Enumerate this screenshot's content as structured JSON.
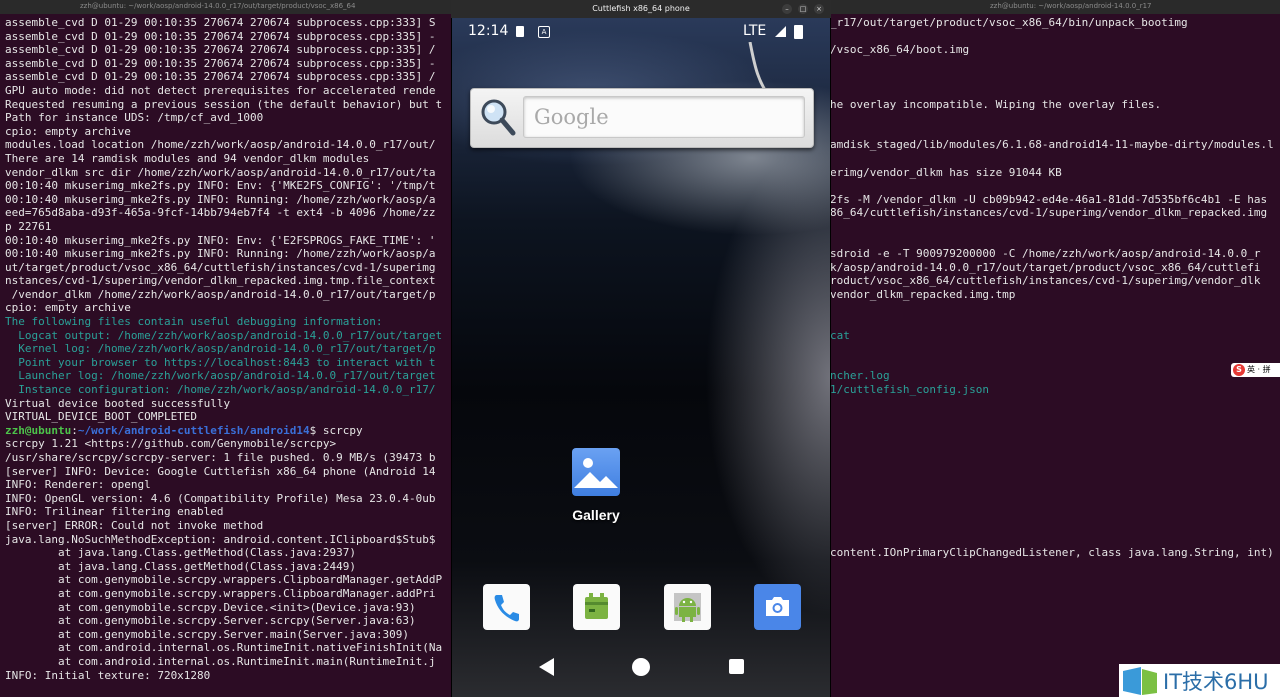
{
  "desktop": {
    "left_tab_title": "zzh@ubuntu: ~/work/aosp/android-14.0.0_r17/out/target/product/vsoc_x86_64",
    "right_tab_title": "zzh@ubuntu: ~/work/aosp/android-14.0.0_r17"
  },
  "terminal": {
    "lines": [
      "assemble_cvd D 01-29 00:10:35 270674 270674 subprocess.cpp:333] S",
      "assemble_cvd D 01-29 00:10:35 270674 270674 subprocess.cpp:335] -",
      "assemble_cvd D 01-29 00:10:35 270674 270674 subprocess.cpp:335] /",
      "assemble_cvd D 01-29 00:10:35 270674 270674 subprocess.cpp:335] -",
      "assemble_cvd D 01-29 00:10:35 270674 270674 subprocess.cpp:335] /",
      "GPU auto mode: did not detect prerequisites for accelerated rende",
      "Requested resuming a previous session (the default behavior) but t",
      "Path for instance UDS: /tmp/cf_avd_1000",
      "cpio: empty archive",
      "modules.load location /home/zzh/work/aosp/android-14.0.0_r17/out/",
      "There are 14 ramdisk modules and 94 vendor_dlkm modules",
      "vendor_dlkm src dir /home/zzh/work/aosp/android-14.0.0_r17/out/ta",
      "00:10:40 mkuserimg_mke2fs.py INFO: Env: {'MKE2FS_CONFIG': '/tmp/t",
      "00:10:40 mkuserimg_mke2fs.py INFO: Running: /home/zzh/work/aosp/a",
      "eed=765d8aba-d93f-465a-9fcf-14bb794eb7f4 -t ext4 -b 4096 /home/zz",
      "p 22761",
      "00:10:40 mkuserimg_mke2fs.py INFO: Env: {'E2FSPROGS_FAKE_TIME': '",
      "00:10:40 mkuserimg_mke2fs.py INFO: Running: /home/zzh/work/aosp/a",
      "ut/target/product/vsoc_x86_64/cuttlefish/instances/cvd-1/superimg",
      "nstances/cvd-1/superimg/vendor_dlkm_repacked.img.tmp.file_context",
      " /vendor_dlkm /home/zzh/work/aosp/android-14.0.0_r17/out/target/p",
      "cpio: empty archive",
      "The following files contain useful debugging information:",
      "  Logcat output: /home/zzh/work/aosp/android-14.0.0_r17/out/target",
      "  Kernel log: /home/zzh/work/aosp/android-14.0.0_r17/out/target/p",
      "  Point your browser to https://localhost:8443 to interact with t",
      "  Launcher log: /home/zzh/work/aosp/android-14.0.0_r17/out/target",
      "  Instance configuration: /home/zzh/work/aosp/android-14.0.0_r17/",
      "Virtual device booted successfully",
      "VIRTUAL_DEVICE_BOOT_COMPLETED"
    ],
    "prompt_user": "zzh@ubuntu",
    "prompt_path": "~/work/android-cuttlefish/android14",
    "prompt_command": "$ scrcpy",
    "lines_after": [
      "scrcpy 1.21 <https://github.com/Genymobile/scrcpy>",
      "/usr/share/scrcpy/scrcpy-server: 1 file pushed. 0.9 MB/s (39473 b",
      "[server] INFO: Device: Google Cuttlefish x86_64 phone (Android 14",
      "INFO: Renderer: opengl",
      "INFO: OpenGL version: 4.6 (Compatibility Profile) Mesa 23.0.4-0ub",
      "INFO: Trilinear filtering enabled",
      "[server] ERROR: Could not invoke method",
      "java.lang.NoSuchMethodException: android.content.IClipboard$Stub$",
      "        at java.lang.Class.getMethod(Class.java:2937)",
      "        at java.lang.Class.getMethod(Class.java:2449)",
      "        at com.genymobile.scrcpy.wrappers.ClipboardManager.getAddP",
      "        at com.genymobile.scrcpy.wrappers.ClipboardManager.addPri",
      "        at com.genymobile.scrcpy.Device.<init>(Device.java:93)",
      "        at com.genymobile.scrcpy.Server.scrcpy(Server.java:63)",
      "        at com.genymobile.scrcpy.Server.main(Server.java:309)",
      "        at com.android.internal.os.RuntimeInit.nativeFinishInit(Na",
      "        at com.android.internal.os.RuntimeInit.main(RuntimeInit.j",
      "INFO: Initial texture: 720x1280"
    ]
  },
  "right_terminal": {
    "lines": [
      "_r17/out/target/product/vsoc_x86_64/bin/unpack_bootimg",
      "",
      "/vsoc_x86_64/boot.img",
      "",
      "",
      "",
      "he overlay incompatible. Wiping the overlay files.",
      "",
      "",
      "amdisk_staged/lib/modules/6.1.68-android14-11-maybe-dirty/modules.l",
      "",
      "erimg/vendor_dlkm has size 91044 KB",
      "",
      "2fs -M /vendor_dlkm -U cb09b942-ed4e-46a1-81dd-7d535bf6c4b1 -E has",
      "86_64/cuttlefish/instances/cvd-1/superimg/vendor_dlkm_repacked.img",
      "",
      "",
      "sdroid -e -T 900979200000 -C /home/zzh/work/aosp/android-14.0.0_r",
      "k/aosp/android-14.0.0_r17/out/target/product/vsoc_x86_64/cuttlefi",
      "roduct/vsoc_x86_64/cuttlefish/instances/cvd-1/superimg/vendor_dlk",
      "vendor_dlkm_repacked.img.tmp",
      "",
      "",
      "cat",
      "",
      "",
      "ncher.log",
      "1/cuttlefish_config.json"
    ],
    "line_java": "content.IOnPrimaryClipChangedListener, class java.lang.String, int)"
  },
  "emulator": {
    "window_title": "Cuttlefish x86_64 phone",
    "minimize": "–",
    "maximize": "□",
    "close": "×",
    "status": {
      "time": "12:14",
      "network": "LTE"
    },
    "search_placeholder": "Google",
    "apps": {
      "gallery_label": "Gallery"
    },
    "dock": [
      "phone-icon",
      "messaging-icon",
      "android-app-icon",
      "camera-icon"
    ]
  },
  "ime_label": "英 · 拼",
  "watermark": {
    "text": "IT技术6HU"
  },
  "colors": {
    "terminal_bg": "#2c0c24",
    "terminal_cyan": "#2aa198",
    "prompt_green": "#4cc34a",
    "prompt_blue": "#3a6fd8",
    "gallery_blue": "#4a86e8",
    "camera_blue": "#4a86e8"
  }
}
